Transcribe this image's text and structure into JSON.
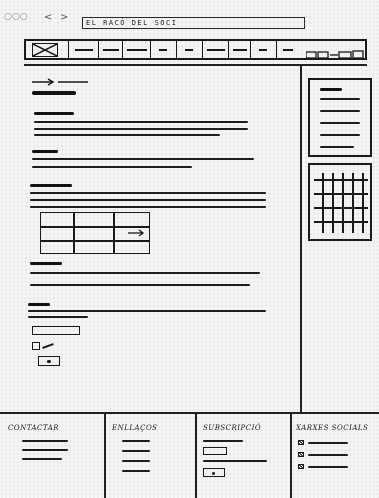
{
  "browser": {
    "window_dots": "○○○",
    "back": "<",
    "forward": ">",
    "address": "EL RACÓ DEL SOCI"
  },
  "footer": {
    "contact_title": "CONTACTAR",
    "links_title": "ENLLAÇOS",
    "subscribe_title": "SUBSCRIPCIÓ",
    "social_title": "XARXES SOCIALS"
  },
  "icons": {
    "logo": "logo-placeholder-icon",
    "breadcrumb_arrow": "arrow-right-icon",
    "social": "social-network-icon"
  },
  "colors": {
    "ink": "#1d1d1d",
    "paper": "#f4f4f1"
  }
}
